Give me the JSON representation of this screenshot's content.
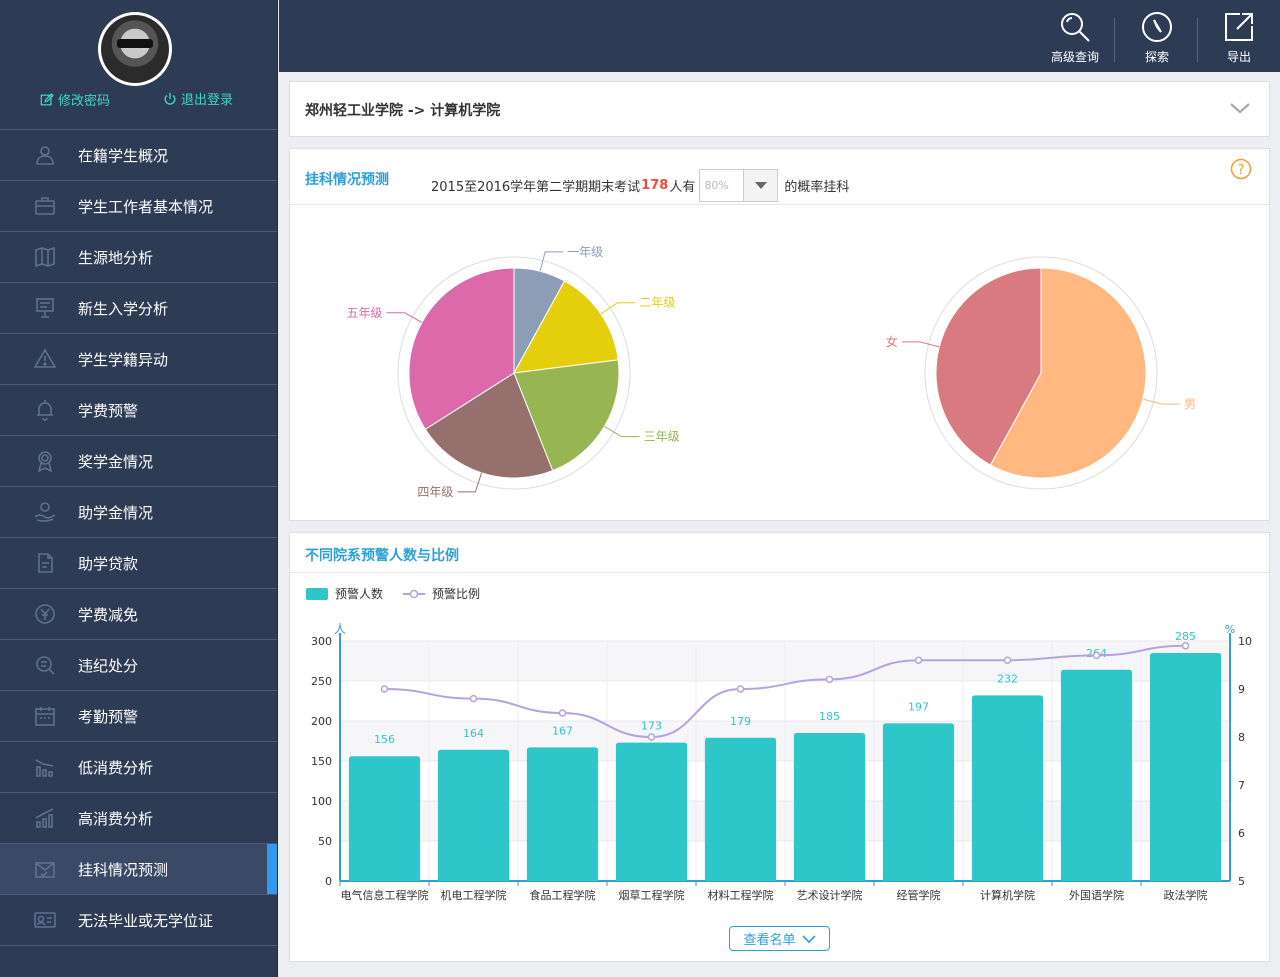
{
  "profile": {
    "edit_password": "修改密码",
    "logout": "退出登录"
  },
  "sidebar": {
    "items": [
      {
        "label": "在籍学生概况",
        "icon": "user-icon"
      },
      {
        "label": "学生工作者基本情况",
        "icon": "briefcase-icon"
      },
      {
        "label": "生源地分析",
        "icon": "map-icon"
      },
      {
        "label": "新生入学分析",
        "icon": "presentation-icon"
      },
      {
        "label": "学生学籍异动",
        "icon": "warning-icon"
      },
      {
        "label": "学费预警",
        "icon": "alarm-bell-icon"
      },
      {
        "label": "奖学金情况",
        "icon": "medal-icon"
      },
      {
        "label": "助学金情况",
        "icon": "hand-money-icon"
      },
      {
        "label": "助学贷款",
        "icon": "loan-document-icon"
      },
      {
        "label": "学费减免",
        "icon": "yuan-circle-icon"
      },
      {
        "label": "违纪处分",
        "icon": "search-violation-icon"
      },
      {
        "label": "考勤预警",
        "icon": "calendar-icon"
      },
      {
        "label": "低消费分析",
        "icon": "low-spending-icon"
      },
      {
        "label": "高消费分析",
        "icon": "high-spending-icon"
      },
      {
        "label": "挂科情况预测",
        "icon": "checked-mail-icon",
        "active": true
      },
      {
        "label": "无法毕业或无学位证",
        "icon": "id-card-icon"
      }
    ]
  },
  "toolbar": {
    "advanced_query": "高级查询",
    "explore": "探索",
    "export": "导出"
  },
  "breadcrumb": {
    "text": "郑州轻工业学院 -> 计算机学院"
  },
  "prediction": {
    "title": "挂科情况预测",
    "prefix": "2015至2016学年第二学期期末考试",
    "count": "178",
    "count_suffix": "人有",
    "probability": "80%",
    "suffix": "的概率挂科"
  },
  "chart_data": [
    {
      "type": "pie",
      "labels": [
        "一年级",
        "二年级",
        "三年级",
        "四年级",
        "五年级"
      ],
      "values": [
        8,
        15,
        21,
        22,
        34
      ],
      "colors": [
        "#8e9db6",
        "#e5cf0d",
        "#97b552",
        "#95706d",
        "#dc69aa"
      ]
    },
    {
      "type": "pie",
      "labels": [
        "男",
        "女"
      ],
      "values": [
        58,
        42
      ],
      "colors": [
        "#ffb980",
        "#d87a80"
      ]
    },
    {
      "type": "bar",
      "title": "不同院系预警人数与比例",
      "categories": [
        "电气信息工程学院",
        "机电工程学院",
        "食品工程学院",
        "烟草工程学院",
        "材料工程学院",
        "艺术设计学院",
        "经管学院",
        "计算机学院",
        "外国语学院",
        "政法学院"
      ],
      "series": [
        {
          "name": "预警人数",
          "type": "bar",
          "color": "#2ec7c9",
          "values": [
            156,
            164,
            167,
            173,
            179,
            185,
            197,
            232,
            264,
            285
          ]
        },
        {
          "name": "预警比例",
          "type": "line",
          "color": "#b6a2de",
          "values": [
            9.0,
            8.8,
            8.5,
            8.0,
            9.0,
            9.2,
            9.6,
            9.6,
            9.7,
            9.9
          ]
        }
      ],
      "ylabel": "人",
      "y2label": "%",
      "ylim": [
        0,
        300
      ],
      "y2lim": [
        5,
        10
      ],
      "yticks": [
        0,
        50,
        100,
        150,
        200,
        250,
        300
      ],
      "y2ticks": [
        5,
        6,
        7,
        8,
        9,
        10
      ],
      "grid": true,
      "legend": "top-left"
    }
  ],
  "bar_panel": {
    "title": "不同院系预警人数与比例",
    "view_list": "查看名单"
  }
}
